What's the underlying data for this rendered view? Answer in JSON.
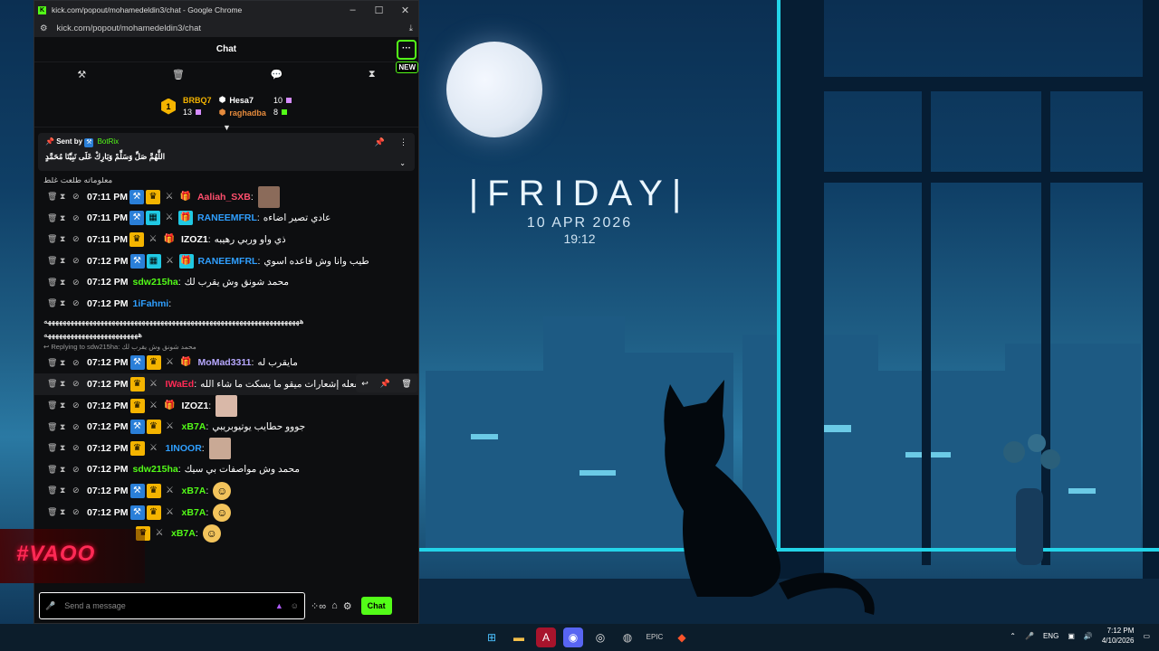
{
  "window": {
    "title": "kick.com/popout/mohamedeldin3/chat - Google Chrome",
    "url": "kick.com/popout/mohamedeldin3/chat"
  },
  "chat": {
    "header_title": "Chat",
    "more_label": "···",
    "new_badge": "NEW",
    "leaderboard": {
      "rank": "1",
      "first": {
        "name": "BRBQ7",
        "count": "13"
      },
      "second": {
        "name": "Hesa7",
        "count": "10"
      },
      "third": {
        "name": "raghadba",
        "count": "8"
      }
    },
    "pinned": {
      "sent_by_label": "Sent by",
      "author": "BotRix",
      "message": "اللَّهُمَّ صَلِّ وَسَلِّمْ وَبَارِكْ عَلَى نَبِيِّنَا مُحَمَّدٍ"
    },
    "partial_top_line": "معلوماته طلعت غلط",
    "messages": [
      {
        "time": "07:11 PM",
        "user": "Aaliah_SXB",
        "color": "#ff4f6d",
        "text": ""
      },
      {
        "time": "07:11 PM",
        "user": "RANEEMFRL",
        "color": "#2f9fff",
        "text": "عادي تصير اضاءه"
      },
      {
        "time": "07:11 PM",
        "user": "IZOZ1",
        "color": "#ffffff",
        "text": "ذي واو وربي رهيبه"
      },
      {
        "time": "07:12 PM",
        "user": "RANEEMFRL",
        "color": "#2f9fff",
        "text": "طيب وانا وش قاعده اسوي"
      },
      {
        "time": "07:12 PM",
        "user": "sdw215ha",
        "color": "#53fc18",
        "text": "محمد شونق وش يقرب لك"
      },
      {
        "time": "07:12 PM",
        "user": "1iFahmi",
        "color": "#2f9fff",
        "text": ""
      },
      {
        "time": "07:12 PM",
        "user": "MoMad3311",
        "color": "#b7a8ff",
        "text": "مايقرب له"
      },
      {
        "time": "07:12 PM",
        "user": "IWaEd",
        "color": "#ff2a55",
        "text": "أنا مفعله إشعارات ميقو ما يسكت ما شاء الله"
      },
      {
        "time": "07:12 PM",
        "user": "IZOZ1",
        "color": "#ffffff",
        "text": ""
      },
      {
        "time": "07:12 PM",
        "user": "xB7A",
        "color": "#53fc18",
        "text": "جووو حطايب يوتيوبريبي"
      },
      {
        "time": "07:12 PM",
        "user": "1INOOR",
        "color": "#2f9fff",
        "text": ""
      },
      {
        "time": "07:12 PM",
        "user": "sdw215ha",
        "color": "#53fc18",
        "text": "محمد وش مواصفات بي سيك"
      },
      {
        "time": "07:12 PM",
        "user": "xB7A",
        "color": "#53fc18",
        "text": ""
      },
      {
        "time": "07:12 PM",
        "user": "xB7A",
        "color": "#53fc18",
        "text": ""
      },
      {
        "time": "",
        "user": "xB7A",
        "color": "#53fc18",
        "text": ""
      }
    ],
    "long_message_line1": "ههههههههههههههههههههههههههههههههههههههههههههههههههههههههههههههههههههه",
    "long_message_line2": "هههههههههههههههههههههههههه",
    "reply_prefix": "Replying to sdw215ha:",
    "reply_quote": "محمد شونق وش يقرب لك",
    "input_placeholder": "Send a message",
    "chat_button": "Chat"
  },
  "overlay_logo": "#VAOO",
  "desktop": {
    "day": "|FRIDAY|",
    "date": "10 APR 2026",
    "time": "19:12"
  },
  "taskbar": {
    "lang": "ENG",
    "clock_time": "7:12 PM",
    "clock_date": "4/10/2026"
  }
}
